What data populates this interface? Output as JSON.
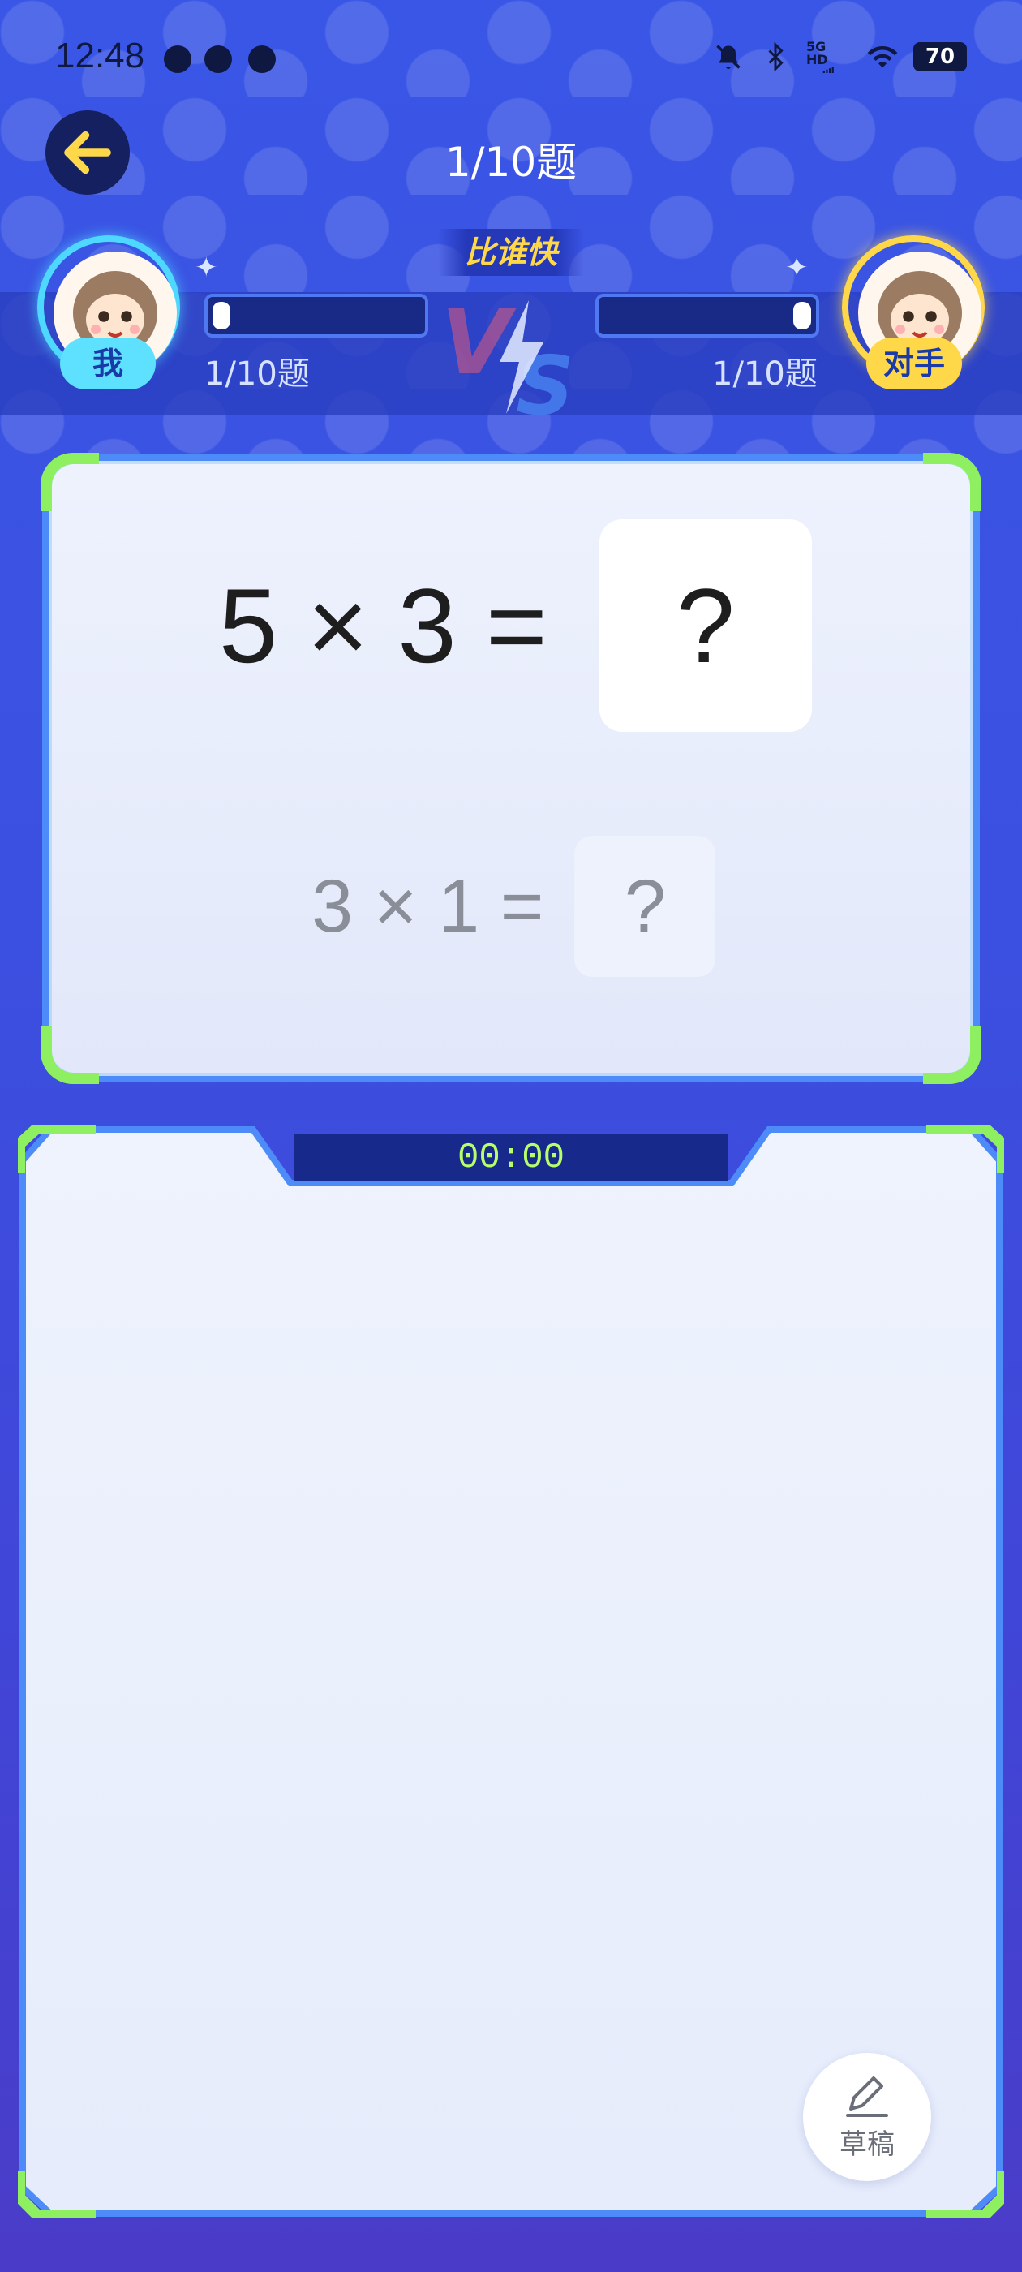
{
  "status_bar": {
    "time": "12:48",
    "signal_label": "5G HD",
    "battery": "70"
  },
  "header": {
    "title": "1/10题"
  },
  "vs": {
    "title": "比谁快",
    "me": {
      "name": "我",
      "progress_text": "1/10题",
      "progress": 0.1
    },
    "opponent": {
      "name": "对手",
      "progress_text": "1/10题",
      "progress": 0.1
    }
  },
  "question": {
    "current": {
      "expression": "5 × 3 =",
      "answer_placeholder": "?"
    },
    "next": {
      "expression": "3 × 1 =",
      "answer_placeholder": "?"
    }
  },
  "answer_panel": {
    "timer": "00:00",
    "draft_label": "草稿"
  },
  "icons": {
    "back": "arrow-left-icon",
    "draft": "pencil-icon"
  },
  "colors": {
    "accent_green": "#8ef060",
    "me_color": "#5ee0ff",
    "opponent_color": "#ffd84a",
    "back_arrow": "#ffd84a"
  }
}
